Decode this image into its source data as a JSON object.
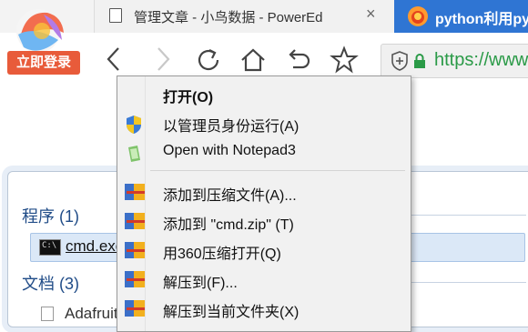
{
  "browser": {
    "tab1_title": "管理文章 - 小鸟数据 - PowerEd",
    "tab1_close": "×",
    "tab2_title": "python利用py",
    "login_badge": "立即登录",
    "address_url": "https://www"
  },
  "start_menu": {
    "section_programs": "程序 (1)",
    "program_result": "cmd.exe",
    "section_documents": "文档 (3)",
    "document_result": "Adafruit"
  },
  "context_menu": {
    "items": [
      {
        "label": "打开(O)",
        "bold": true,
        "icon": "none"
      },
      {
        "label": "以管理员身份运行(A)",
        "icon": "uac-shield-icon"
      },
      {
        "label": "Open with Notepad3",
        "icon": "notepad3-icon"
      },
      {
        "label": "添加到压缩文件(A)...",
        "icon": "archive-icon"
      },
      {
        "label": "添加到 \"cmd.zip\" (T)",
        "icon": "archive-icon"
      },
      {
        "label": "用360压缩打开(Q)",
        "icon": "archive-icon"
      },
      {
        "label": "解压到(F)...",
        "icon": "archive-icon"
      },
      {
        "label": "解压到当前文件夹(X)",
        "icon": "archive-icon"
      }
    ]
  },
  "colors": {
    "active_tab": "#2f75d3",
    "login_badge": "#e85b3a",
    "url_secure": "#2a9a47"
  }
}
